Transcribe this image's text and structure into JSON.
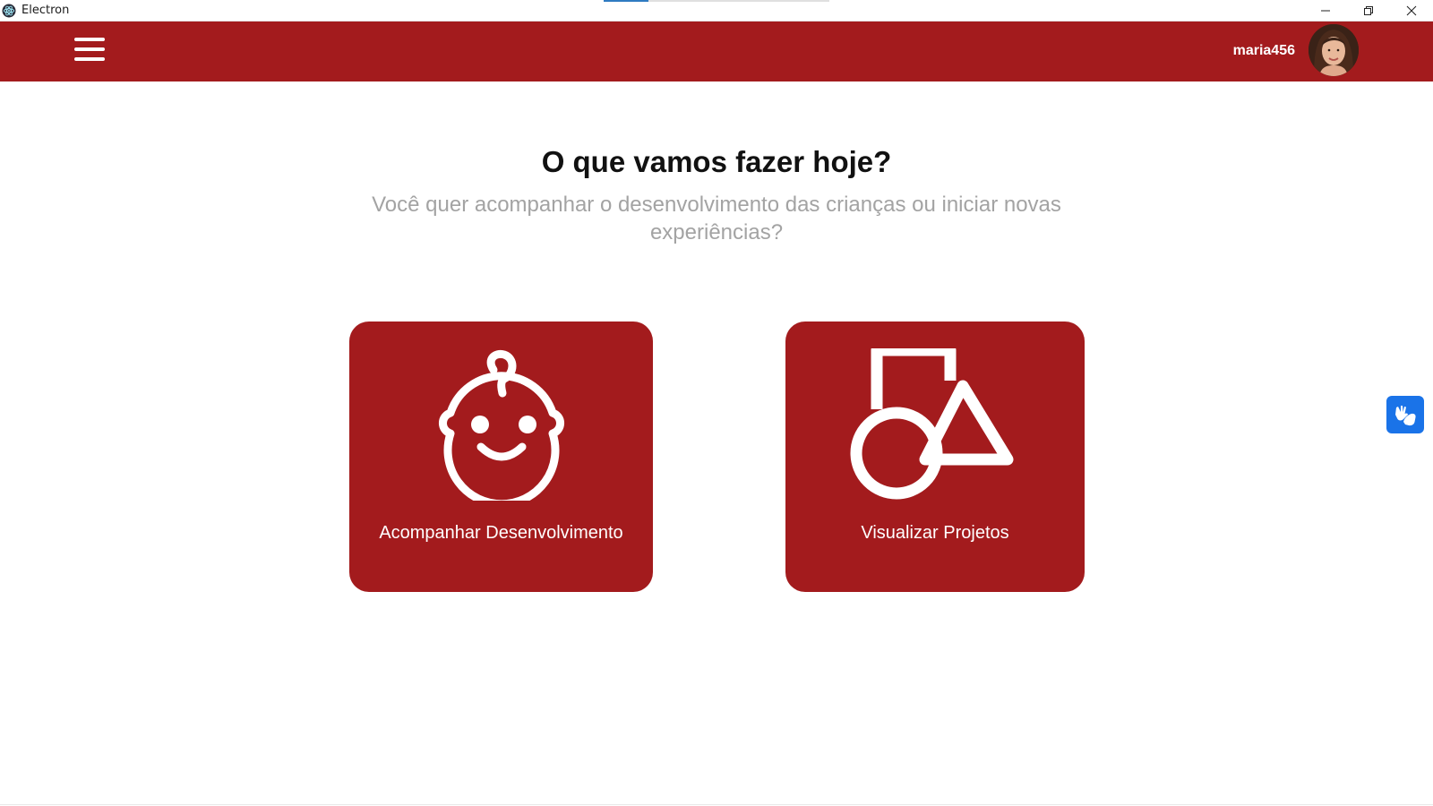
{
  "window": {
    "title": "Electron",
    "loading_progress": 0.2
  },
  "header": {
    "menu_icon": "hamburger-menu-icon",
    "username": "maria456",
    "avatar": "user-avatar-photo"
  },
  "main": {
    "title": "O que vamos fazer hoje?",
    "subtitle": "Você quer acompanhar o desenvolvimento das crianças ou iniciar novas experiências?",
    "cards": [
      {
        "label": "Acompanhar Desenvolvimento",
        "icon": "baby-face-icon"
      },
      {
        "label": "Visualizar Projetos",
        "icon": "shapes-icon"
      }
    ]
  },
  "accessibility": {
    "icon": "sign-language-hands-icon"
  },
  "colors": {
    "brand_red": "#a31b1d",
    "accent_blue": "#1a73e8",
    "subtitle_gray": "#a3a3a3"
  }
}
